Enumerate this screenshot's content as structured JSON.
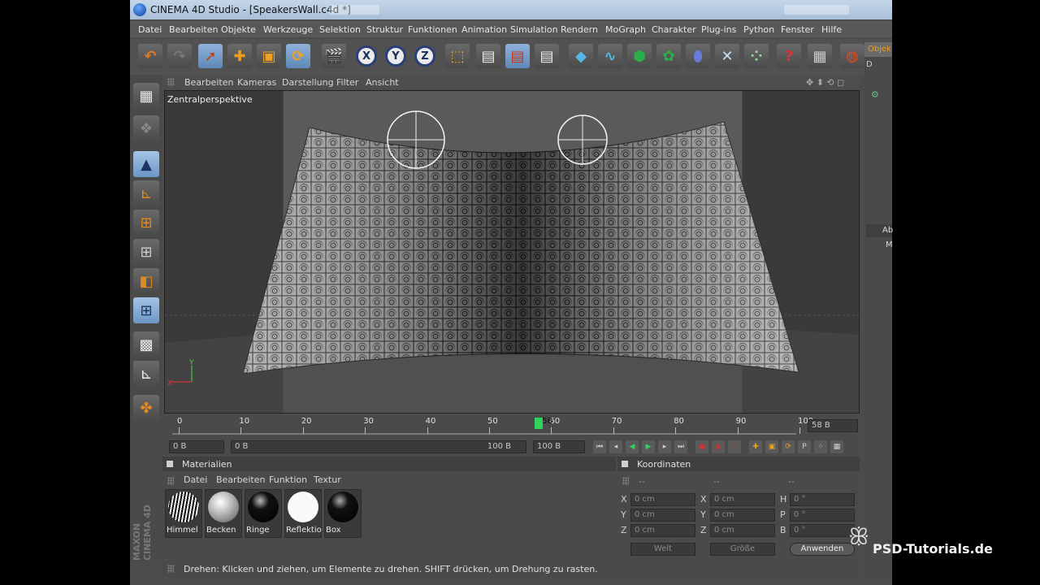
{
  "window": {
    "title": "CINEMA 4D Studio - [SpeakersWall.c4d *]"
  },
  "menu": [
    "Datei",
    "Bearbeiten",
    "Objekte",
    "Werkzeuge",
    "Selektion",
    "Struktur",
    "Funktionen",
    "Animation",
    "Simulation",
    "Rendern",
    "MoGraph",
    "Charakter",
    "Plug-ins",
    "Python",
    "Fenster",
    "Hilfe"
  ],
  "toolbar": {
    "icons": [
      "undo-icon",
      "redo-icon",
      "live-select-icon",
      "move-icon",
      "scale-icon",
      "rotate-icon",
      "record-keyframe-icon",
      "x-axis-icon",
      "y-axis-icon",
      "z-axis-icon",
      "coordinate-system-icon",
      "render-view-icon",
      "render-picture-viewer-icon",
      "render-settings-icon",
      "cube-icon",
      "spline-icon",
      "nurbs-icon",
      "array-icon",
      "deformer-icon",
      "scene-icon",
      "particles-icon",
      "help-icon",
      "layout-icon",
      "web-icon"
    ],
    "axis_labels": [
      "X",
      "Y",
      "Z"
    ]
  },
  "right_tab": {
    "label": "Objek",
    "sub": "D",
    "a": "Ab",
    "m": "M"
  },
  "viewport": {
    "menu": [
      "Bearbeiten",
      "Kameras",
      "Darstellung",
      "Filter",
      "Ansicht"
    ],
    "label": "Zentralperspektive",
    "axis": {
      "y": "Y",
      "x": "X"
    }
  },
  "timeline": {
    "ticks": [
      "0",
      "10",
      "20",
      "30",
      "40",
      "50",
      "60",
      "70",
      "80",
      "90",
      "100"
    ],
    "current": "58",
    "frame_field": "58 B"
  },
  "controls": {
    "start": "0 B",
    "range_start": "0 B",
    "range_end": "100 B",
    "end": "100 B"
  },
  "materials": {
    "title": "Materialien",
    "menu": [
      "Datei",
      "Bearbeiten",
      "Funktion",
      "Textur"
    ],
    "items": [
      "Himmel",
      "Becken",
      "Ringe",
      "Reflektio",
      "Box"
    ]
  },
  "coordinates": {
    "title": "Koordinaten",
    "col_headers": [
      "--",
      "--",
      "--"
    ],
    "rows": [
      {
        "a": "X",
        "av": "0 cm",
        "b": "X",
        "bv": "0 cm",
        "c": "H",
        "cv": "0 °"
      },
      {
        "a": "Y",
        "av": "0 cm",
        "b": "Y",
        "bv": "0 cm",
        "c": "P",
        "cv": "0 °"
      },
      {
        "a": "Z",
        "av": "0 cm",
        "b": "Z",
        "bv": "0 cm",
        "c": "B",
        "cv": "0 °"
      }
    ],
    "mode": "Welt",
    "size": "Größe",
    "apply": "Anwenden"
  },
  "status": "Drehen: Klicken und ziehen, um Elemente zu drehen. SHIFT drücken, um Drehung zu rasten.",
  "branding": {
    "maxon": "MAXON",
    "c4d": "CINEMA 4D",
    "watermark": "PSD-Tutorials.de"
  }
}
